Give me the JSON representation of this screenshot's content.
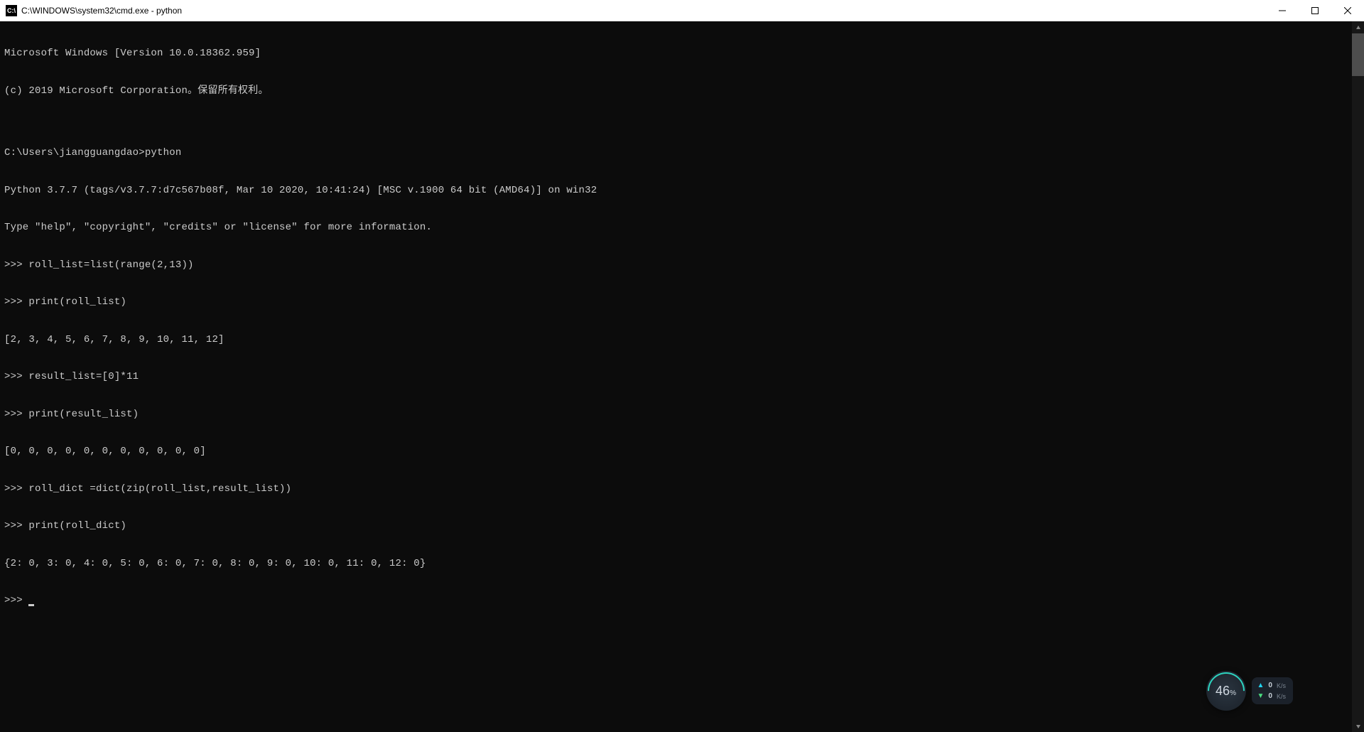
{
  "titlebar": {
    "icon_text": "C:\\",
    "title": "C:\\WINDOWS\\system32\\cmd.exe - python"
  },
  "terminal": {
    "lines": [
      "Microsoft Windows [Version 10.0.18362.959]",
      "(c) 2019 Microsoft Corporation。保留所有权利。",
      "",
      "C:\\Users\\jiangguangdao>python",
      "Python 3.7.7 (tags/v3.7.7:d7c567b08f, Mar 10 2020, 10:41:24) [MSC v.1900 64 bit (AMD64)] on win32",
      "Type \"help\", \"copyright\", \"credits\" or \"license\" for more information.",
      ">>> roll_list=list(range(2,13))",
      ">>> print(roll_list)",
      "[2, 3, 4, 5, 6, 7, 8, 9, 10, 11, 12]",
      ">>> result_list=[0]*11",
      ">>> print(result_list)",
      "[0, 0, 0, 0, 0, 0, 0, 0, 0, 0, 0]",
      ">>> roll_dict =dict(zip(roll_list,result_list))",
      ">>> print(roll_dict)",
      "{2: 0, 3: 0, 4: 0, 5: 0, 6: 0, 7: 0, 8: 0, 9: 0, 10: 0, 11: 0, 12: 0}"
    ],
    "prompt": ">>> "
  },
  "widget": {
    "percent": "46",
    "percent_sign": "%",
    "upload_value": "0",
    "upload_unit": "K/s",
    "download_value": "0",
    "download_unit": "K/s"
  }
}
